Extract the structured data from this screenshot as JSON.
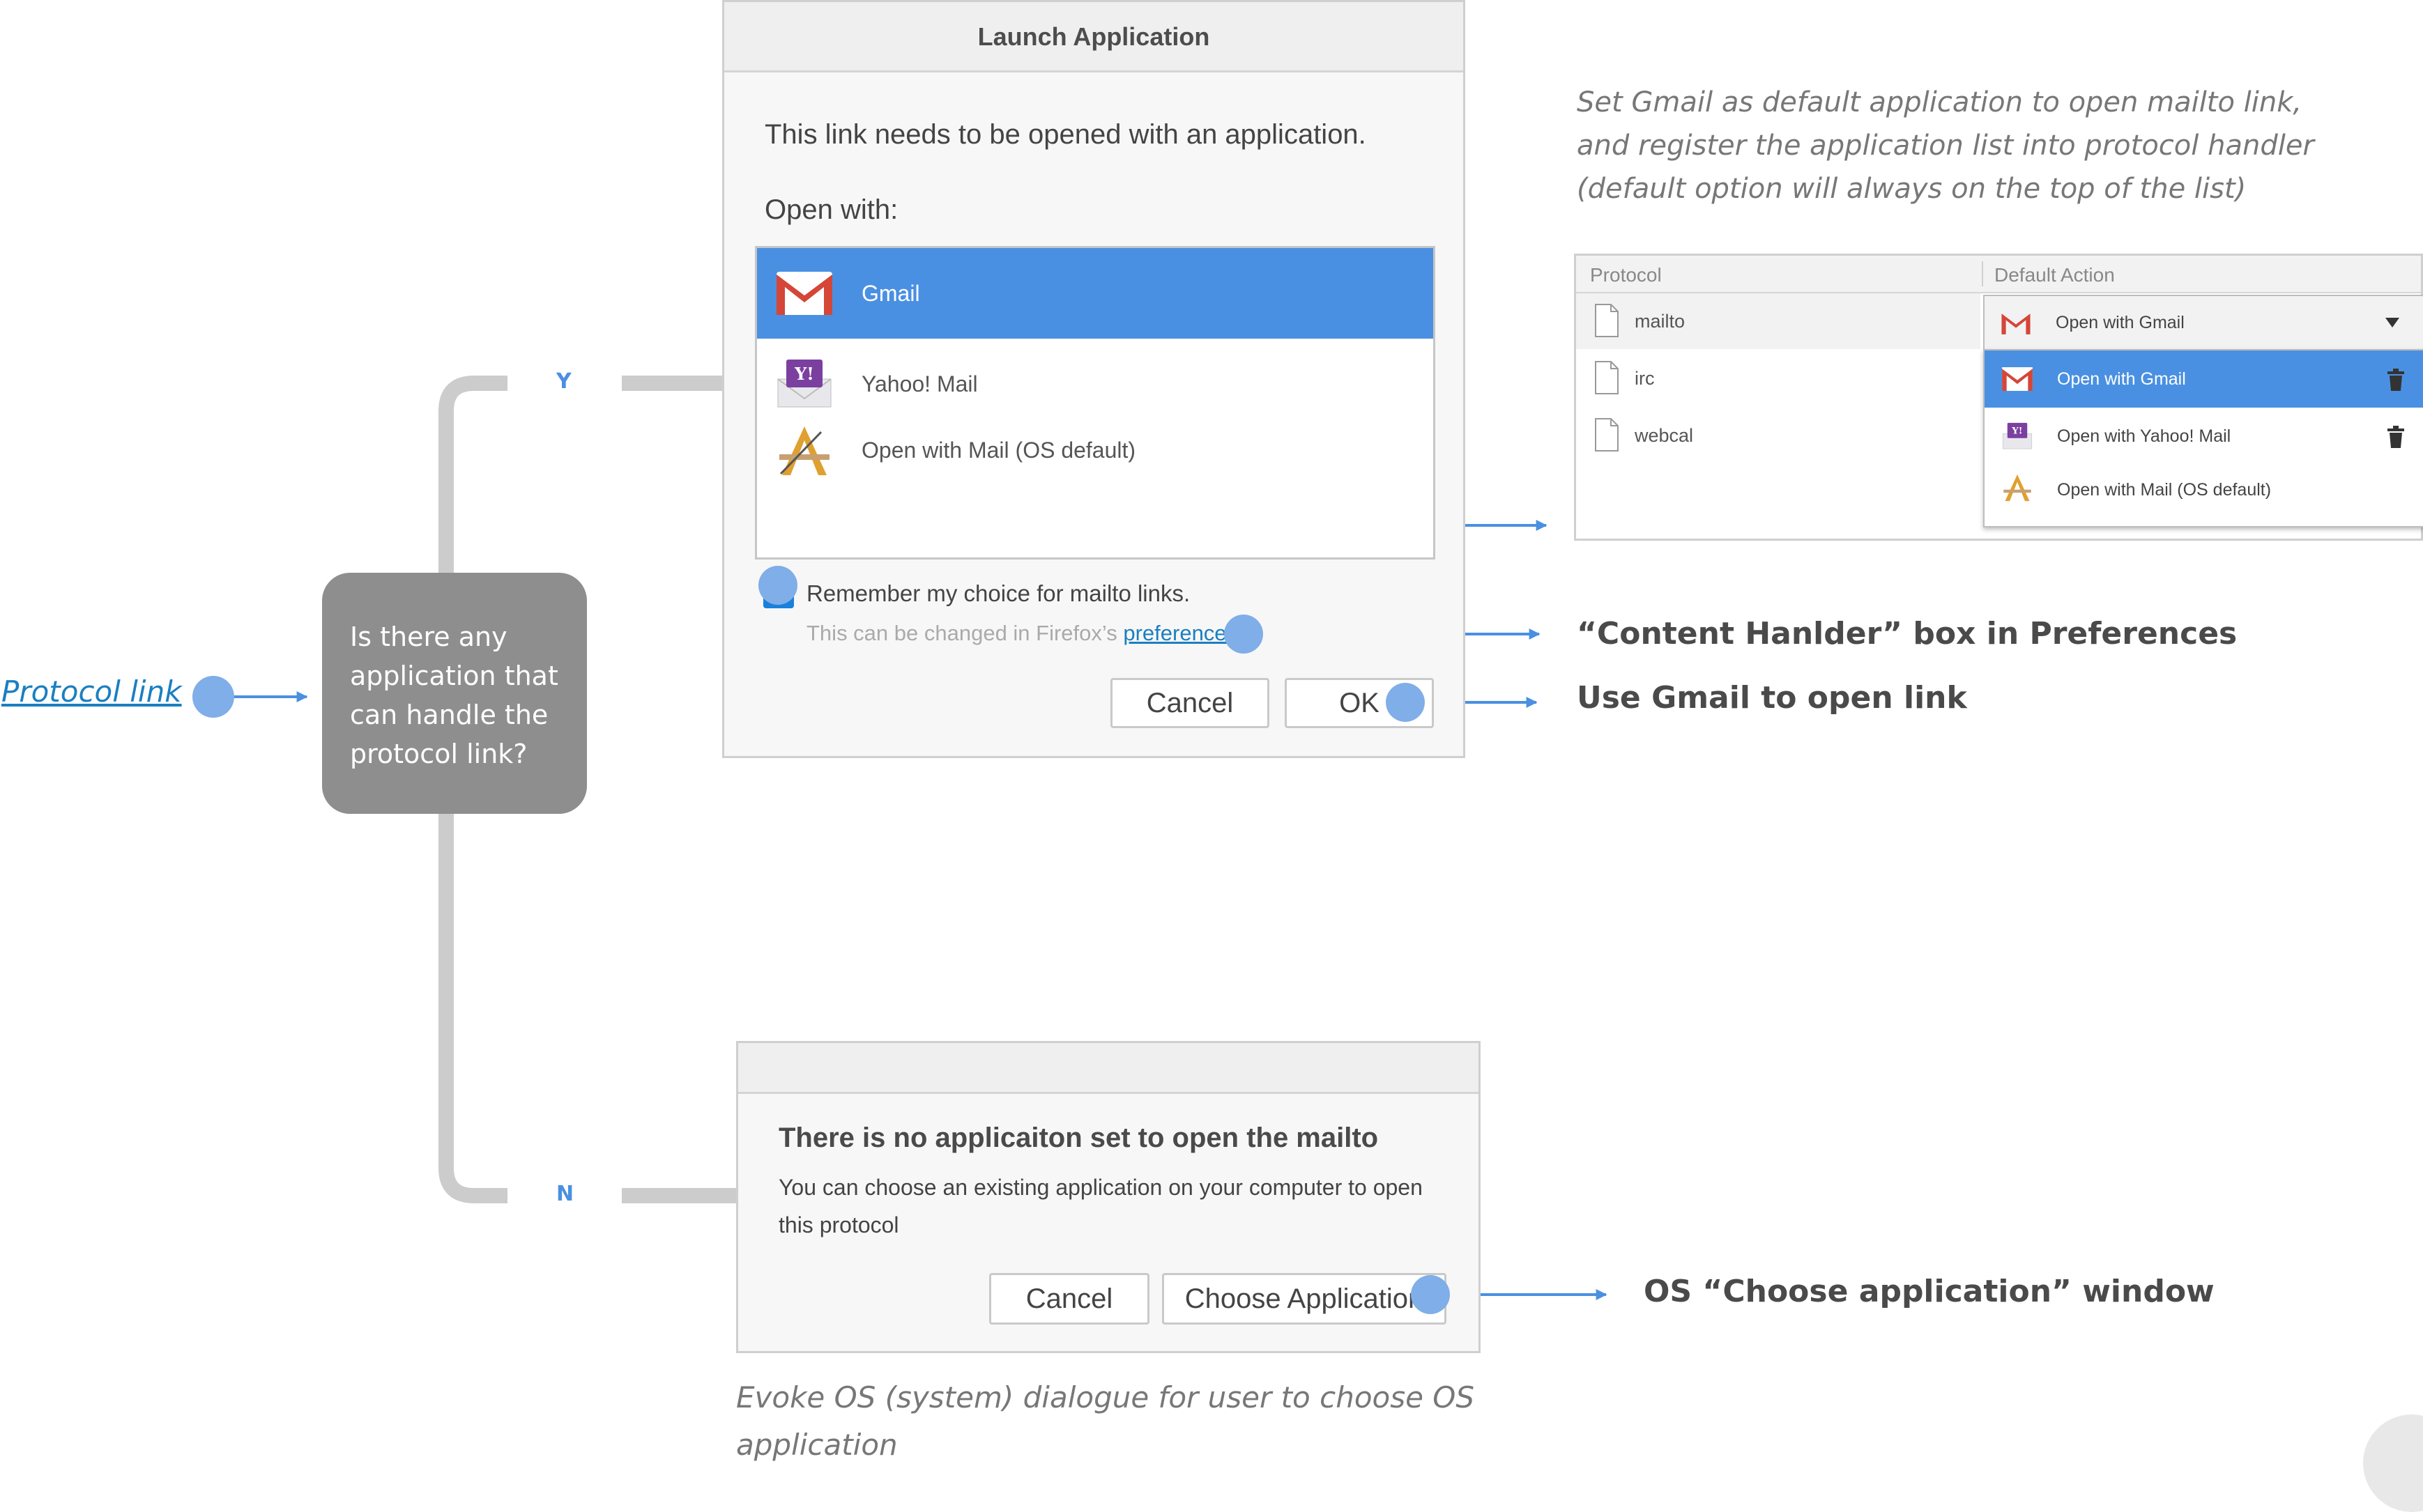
{
  "protocol_link": "Protocol link",
  "decision": {
    "lines": [
      "Is there any",
      "application that",
      "can handle the",
      "protocol link?"
    ],
    "yes_label": "Y",
    "no_label": "N"
  },
  "launch_dialog": {
    "title": "Launch Application",
    "message": "This link needs to be opened with an application.",
    "open_with": "Open with:",
    "apps": [
      {
        "icon": "gmail-icon",
        "label": "Gmail",
        "selected": true
      },
      {
        "icon": "yahoo-mail-icon",
        "label": "Yahoo! Mail",
        "selected": false
      },
      {
        "icon": "os-mail-icon",
        "label": "Open with Mail (OS default)",
        "selected": false
      }
    ],
    "remember_label": "Remember my choice for mailto links.",
    "remember_checked": true,
    "changed_prefix": "This can be changed in Firefox’s ",
    "changed_link": "preferences",
    "changed_suffix": ".",
    "cancel": "Cancel",
    "ok": "OK"
  },
  "annotations": {
    "set_gmail_lines": [
      "Set Gmail as default application to open mailto link,",
      "and register the application list into protocol handler",
      "(default option will always on the top of the list)"
    ],
    "content_handler": "“Content Hanlder” box in Preferences",
    "use_gmail": "Use Gmail to open link",
    "os_choose": "OS “Choose application” window",
    "evoke_lines": [
      "Evoke OS (system) dialogue for user to choose OS",
      "application"
    ]
  },
  "preferences": {
    "col_protocol": "Protocol",
    "col_action": "Default Action",
    "protocols": [
      "mailto",
      "irc",
      "webcal"
    ],
    "dropdown_value": "Open with Gmail",
    "options": [
      {
        "icon": "gmail-icon",
        "label": "Open with Gmail",
        "selected": true,
        "deletable": true
      },
      {
        "icon": "yahoo-mail-icon",
        "label": "Open with Yahoo! Mail",
        "selected": false,
        "deletable": true
      },
      {
        "icon": "os-mail-icon",
        "label": "Open with Mail (OS default)",
        "selected": false,
        "deletable": false
      }
    ]
  },
  "no_app_dialog": {
    "heading": "There is no applicaiton set to open the mailto",
    "body": "You can choose an existing application on your computer to open this protocol",
    "cancel": "Cancel",
    "choose": "Choose Application"
  },
  "colors": {
    "accent": "#4a90e2",
    "connector": "#cccccc",
    "decision": "#8e8e8e"
  }
}
